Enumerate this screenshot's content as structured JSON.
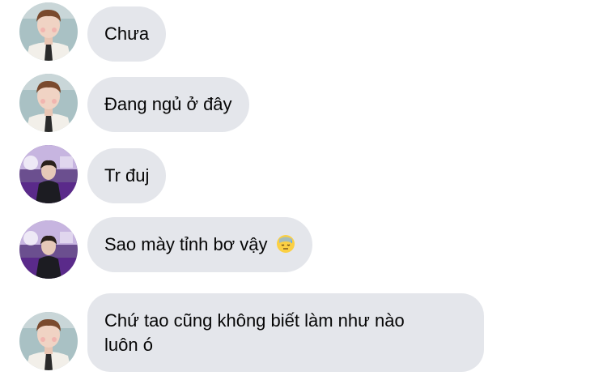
{
  "conversation": {
    "messages": [
      {
        "text": "Chưa",
        "avatar": "avatar-man-tie"
      },
      {
        "text": "Đang ngủ ở đây",
        "avatar": "avatar-man-tie"
      },
      {
        "text": "Tr đuj",
        "avatar": "avatar-person-purple-room"
      },
      {
        "text": "Sao mày tỉnh bơ vậy",
        "emoji": "downcast-face-with-sweat-icon",
        "avatar": "avatar-person-purple-room"
      },
      {
        "text_line1": "Chứ tao cũng không biết làm như nào",
        "text_line2": "luôn ó",
        "avatar": "avatar-man-tie"
      }
    ]
  },
  "colors": {
    "bubble_bg": "#e4e6eb",
    "text": "#050505",
    "background": "#ffffff"
  }
}
